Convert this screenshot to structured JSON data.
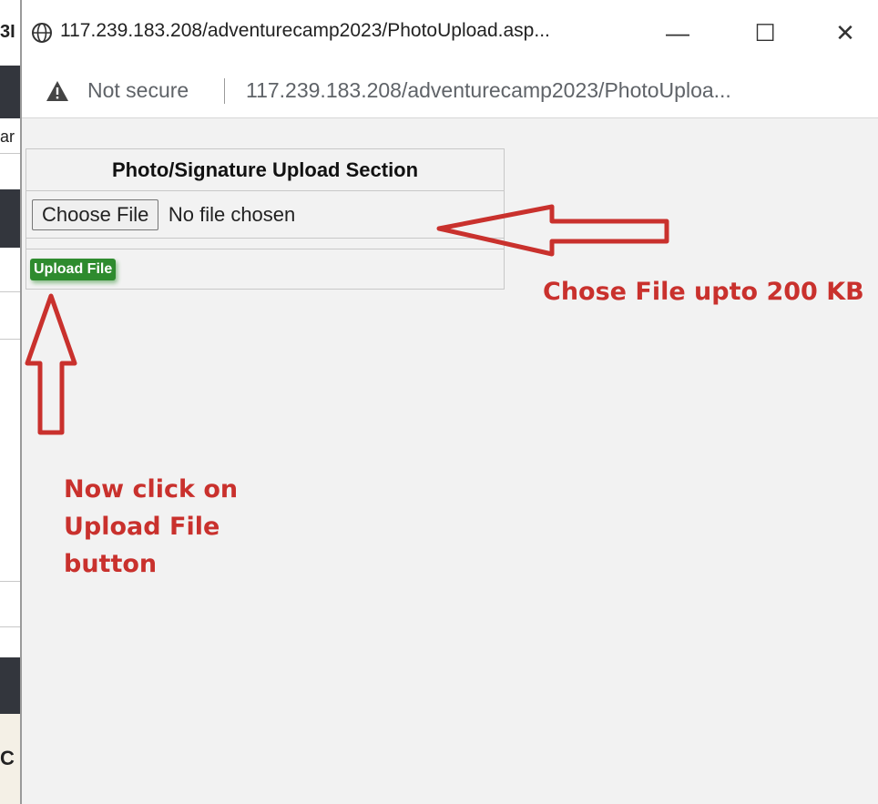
{
  "background_page": {
    "fragments": [
      "3I",
      "ar",
      "C"
    ]
  },
  "window": {
    "title": "117.239.183.208/adventurecamp2023/PhotoUpload.asp...",
    "controls": {
      "minimize": "—",
      "maximize": "☐",
      "close": "✕"
    },
    "icons": {
      "site": "globe-icon",
      "warning": "warning-triangle-icon"
    }
  },
  "addressbar": {
    "security_label": "Not secure",
    "url": "117.239.183.208/adventurecamp2023/PhotoUploa..."
  },
  "upload_section": {
    "title": "Photo/Signature Upload Section",
    "choose_file_label": "Choose File",
    "file_status": "No file chosen",
    "upload_button_label": "Upload File"
  },
  "annotations": {
    "file_hint": "Chose File upto 200 KB",
    "upload_hint": "Now click on Upload File button",
    "color": "#c9312d"
  },
  "colors": {
    "upload_button": "#2e8b2e",
    "annotation_red": "#c9312d"
  }
}
